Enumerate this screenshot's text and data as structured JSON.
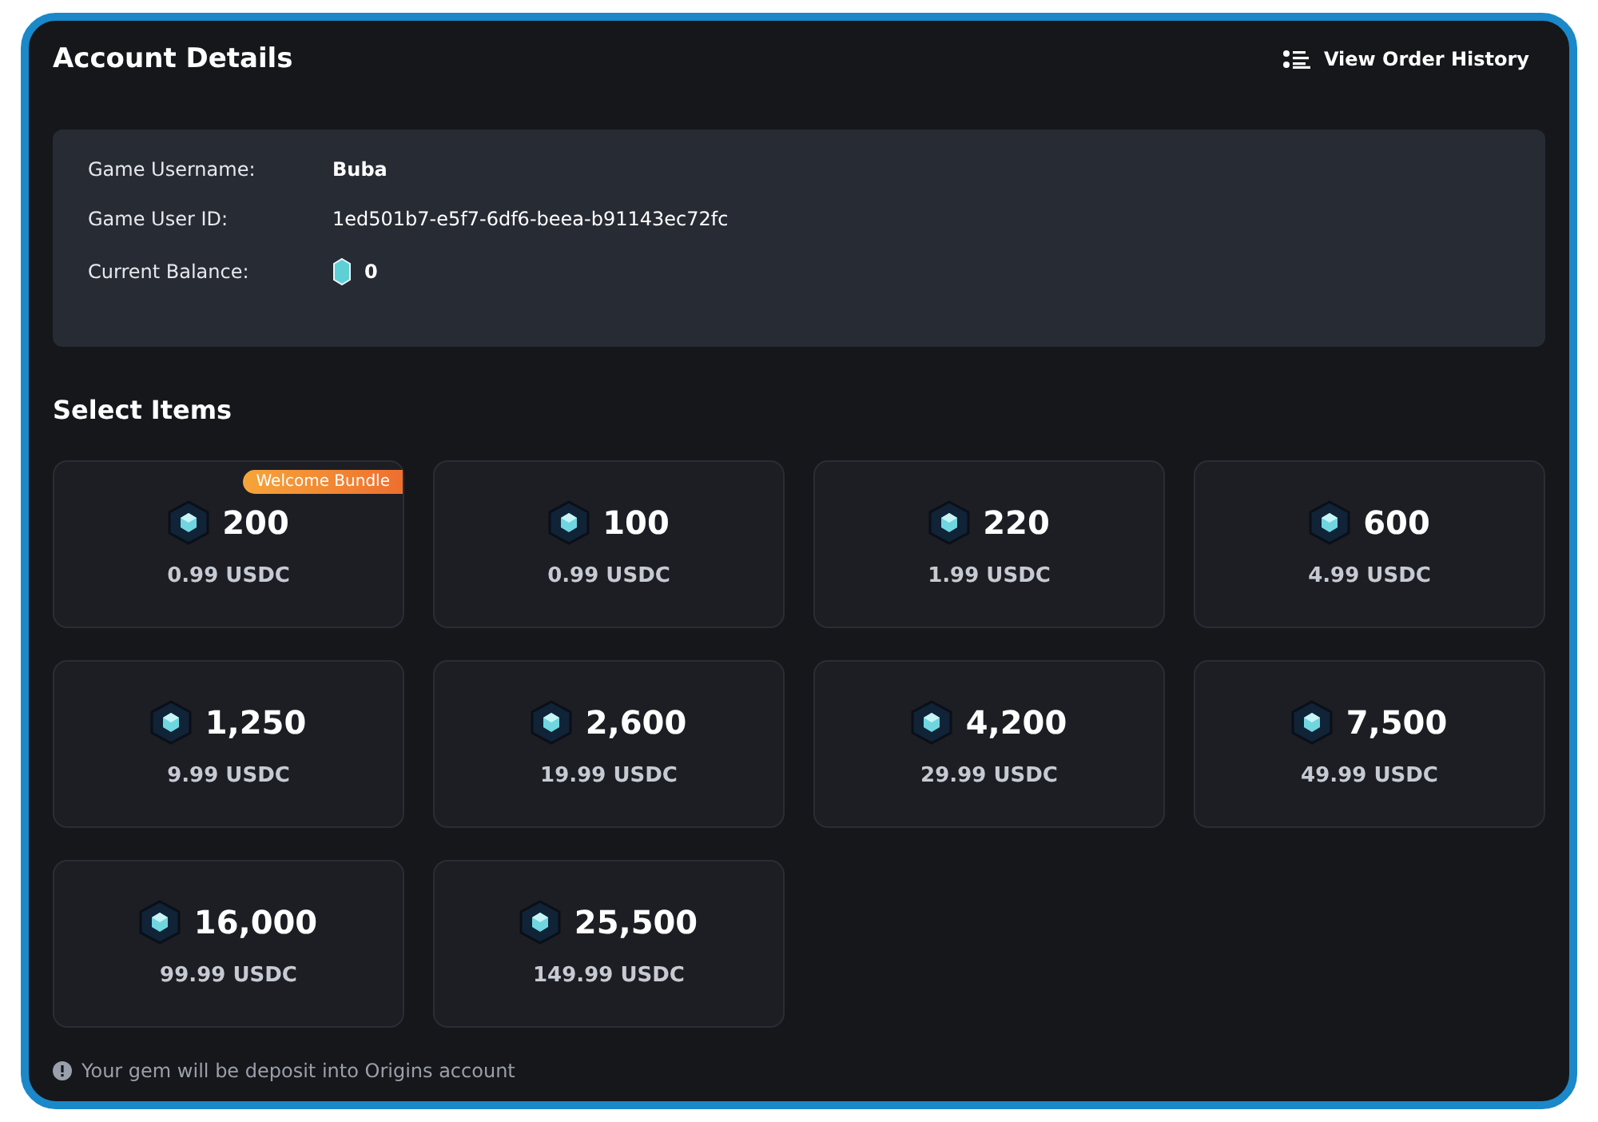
{
  "header": {
    "title": "Account Details",
    "history_link": "View Order History"
  },
  "account": [
    {
      "label": "Game Username:",
      "value": "Buba",
      "kind": "bold"
    },
    {
      "label": "Game User ID:",
      "value": "1ed501b7-e5f7-6df6-beea-b91143ec72fc",
      "kind": "plain"
    },
    {
      "label": "Current Balance:",
      "value": "0",
      "kind": "gem"
    }
  ],
  "section_title": "Select Items",
  "items": [
    {
      "amount": "200",
      "price": "0.99 USDC",
      "badge": "Welcome Bundle"
    },
    {
      "amount": "100",
      "price": "0.99 USDC"
    },
    {
      "amount": "220",
      "price": "1.99 USDC"
    },
    {
      "amount": "600",
      "price": "4.99 USDC"
    },
    {
      "amount": "1,250",
      "price": "9.99 USDC"
    },
    {
      "amount": "2,600",
      "price": "19.99 USDC"
    },
    {
      "amount": "4,200",
      "price": "29.99 USDC"
    },
    {
      "amount": "7,500",
      "price": "49.99 USDC"
    },
    {
      "amount": "16,000",
      "price": "99.99 USDC"
    },
    {
      "amount": "25,500",
      "price": "149.99 USDC"
    }
  ],
  "footer_note": "Your gem will be deposit into Origins account"
}
